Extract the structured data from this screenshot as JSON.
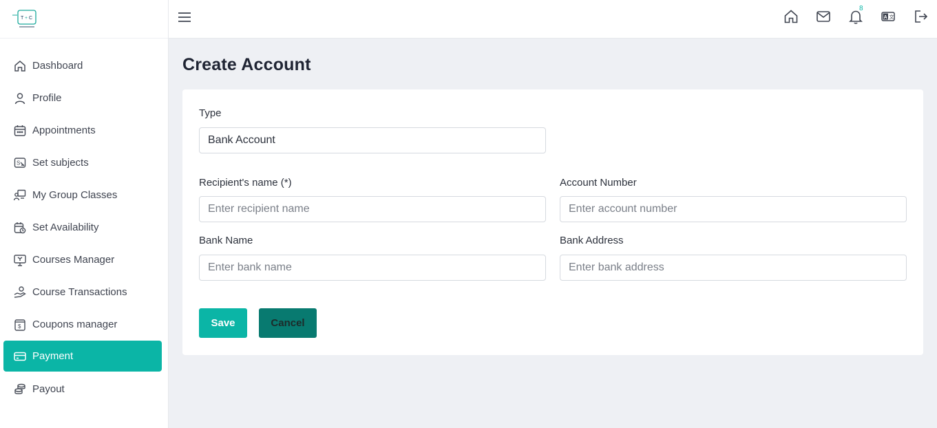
{
  "sidebar": {
    "items": [
      {
        "label": "Dashboard",
        "icon": "home-icon"
      },
      {
        "label": "Profile",
        "icon": "user-icon"
      },
      {
        "label": "Appointments",
        "icon": "calendar-icon"
      },
      {
        "label": "Set subjects",
        "icon": "subjects-icon"
      },
      {
        "label": "My Group Classes",
        "icon": "group-class-icon"
      },
      {
        "label": "Set Availability",
        "icon": "calendar-clock-icon"
      },
      {
        "label": "Courses Manager",
        "icon": "monitor-icon"
      },
      {
        "label": "Course Transactions",
        "icon": "hand-coin-icon"
      },
      {
        "label": "Coupons manager",
        "icon": "coupon-icon"
      },
      {
        "label": "Payment",
        "icon": "card-icon",
        "active": true
      },
      {
        "label": "Payout",
        "icon": "coins-icon"
      }
    ]
  },
  "topbar": {
    "notification_count": "8",
    "icons": [
      "menu-icon",
      "home-icon",
      "mail-icon",
      "bell-icon",
      "language-icon",
      "logout-icon"
    ]
  },
  "page": {
    "title": "Create Account"
  },
  "form": {
    "type_label": "Type",
    "type_value": "Bank Account",
    "recipient_label": "Recipient's name (*)",
    "recipient_placeholder": "Enter recipient name",
    "account_label": "Account Number",
    "account_placeholder": "Enter account number",
    "bank_name_label": "Bank Name",
    "bank_name_placeholder": "Enter bank name",
    "bank_address_label": "Bank Address",
    "bank_address_placeholder": "Enter bank address",
    "save_label": "Save",
    "cancel_label": "Cancel"
  },
  "colors": {
    "accent": "#0bb5a6",
    "accent_dark": "#087a70",
    "background": "#eef0f4"
  }
}
